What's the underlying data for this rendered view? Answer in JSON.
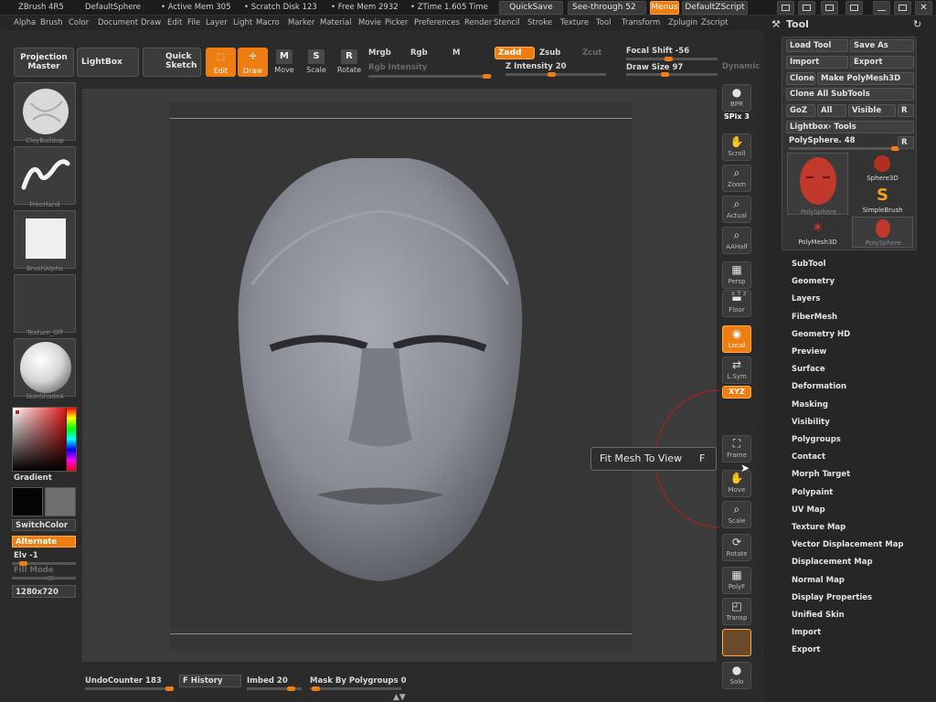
{
  "title_bar": {
    "app": "ZBrush 4R5",
    "doc": "DefaultSphere",
    "active_mem": "• Active Mem 305",
    "scratch": "• Scratch Disk 123",
    "free_mem": "• Free Mem 2932",
    "ztime": "• ZTime 1.605 Time",
    "quicksave": "QuickSave",
    "see_through_label": "See-through",
    "see_through_value": "52",
    "menus": "Menus",
    "zscript": "DefaultZScript"
  },
  "menu_bar": [
    "Alpha",
    "Brush",
    "Color",
    "Document",
    "Draw",
    "Edit",
    "File",
    "Layer",
    "Light",
    "Macro",
    "Marker",
    "Material",
    "Movie",
    "Picker",
    "Preferences",
    "Render",
    "Stencil",
    "Stroke",
    "Texture",
    "Tool",
    "Transform",
    "Zplugin",
    "Zscript"
  ],
  "toolbar": {
    "projection_master": "Projection Master",
    "lightbox": "LightBox",
    "quick_sketch": "Quick Sketch",
    "edit": "Edit",
    "draw": "Draw",
    "move": "Move",
    "scale": "Scale",
    "rotate": "Rotate",
    "mrgb": "Mrgb",
    "rgb": "Rgb",
    "m": "M",
    "zadd": "Zadd",
    "zsub": "Zsub",
    "zcut": "Zcut",
    "rgb_intensity": "Rgb Intensity",
    "z_intensity": "Z Intensity 20",
    "focal_shift": "Focal Shift -56",
    "draw_size": "Draw Size 97",
    "dynamic": "Dynamic"
  },
  "left_shelf": {
    "brush_caption": "ClayBuildup",
    "stroke_caption": "FreeHand",
    "alpha_caption": "BrushAlpha",
    "texture_caption": "Texture_Off",
    "material_caption": "SkinShade4",
    "gradient": "Gradient",
    "switch_color": "SwitchColor",
    "alternate": "Alternate",
    "elv": "Elv -1",
    "fill_mode": "Fill Mode",
    "doc_size": "1280x720"
  },
  "right_strip": [
    {
      "icon": "bpr-icon",
      "label": "BPR"
    },
    {
      "icon": "spix-icon",
      "label": "SPix 3"
    },
    {
      "icon": "scroll-icon",
      "label": "Scroll"
    },
    {
      "icon": "zoom-icon",
      "label": "Zoom"
    },
    {
      "icon": "actual-icon",
      "label": "Actual"
    },
    {
      "icon": "aahalf-icon",
      "label": "AAHalf"
    },
    {
      "icon": "persp-icon",
      "label": "Persp"
    },
    {
      "icon": "floor-icon",
      "label": "Floor"
    },
    {
      "icon": "local-icon",
      "label": "Local"
    },
    {
      "icon": "lsym-icon",
      "label": "L.Sym"
    },
    {
      "icon": "xyz-icon",
      "label": "XYZ"
    },
    {
      "icon": "frame-icon",
      "label": "Frame"
    },
    {
      "icon": "move-icon",
      "label": "Move"
    },
    {
      "icon": "scale-icon",
      "label": "Scale"
    },
    {
      "icon": "rotate-icon",
      "label": "Rotate"
    },
    {
      "icon": "polyf-icon",
      "label": "PolyF"
    },
    {
      "icon": "transp-icon",
      "label": "Transp"
    },
    {
      "icon": "ghost-icon",
      "label": ""
    },
    {
      "icon": "solo-icon",
      "label": "Solo"
    }
  ],
  "xyz_hint": "x Y z",
  "tooltip": {
    "text": "Fit Mesh To View",
    "key": "F"
  },
  "tool_panel": {
    "title": "Tool",
    "load_tool": "Load Tool",
    "save_as": "Save As",
    "import": "Import",
    "export": "Export",
    "clone": "Clone",
    "make_polymesh3d": "Make PolyMesh3D",
    "clone_all_subtools": "Clone All SubTools",
    "goz": "GoZ",
    "all": "All",
    "visible": "Visible",
    "r": "R",
    "lightbox_tools": "Lightbox› Tools",
    "polysphere_slider": "PolySphere. 48",
    "thumbs": [
      "PolySphere",
      "Sphere3D",
      "SimpleBrush",
      "PolyMesh3D",
      "PolySphere"
    ]
  },
  "tool_menu": [
    "SubTool",
    "Geometry",
    "Layers",
    "FiberMesh",
    "Geometry HD",
    "Preview",
    "Surface",
    "Deformation",
    "Masking",
    "Visibility",
    "Polygroups",
    "Contact",
    "Morph Target",
    "Polypaint",
    "UV Map",
    "Texture Map",
    "Vector Displacement Map",
    "Displacement Map",
    "Normal Map",
    "Display Properties",
    "Unified Skin",
    "Import",
    "Export"
  ],
  "bottom_bar": {
    "undo_counter": "UndoCounter 183",
    "history": "F History",
    "imbed": "Imbed 20",
    "mask_polygroups": "Mask By Polygroups 0"
  },
  "colors": {
    "accent": "#ee7d12",
    "panel": "#2b2b2b",
    "canvas": "#3c3c3c"
  }
}
